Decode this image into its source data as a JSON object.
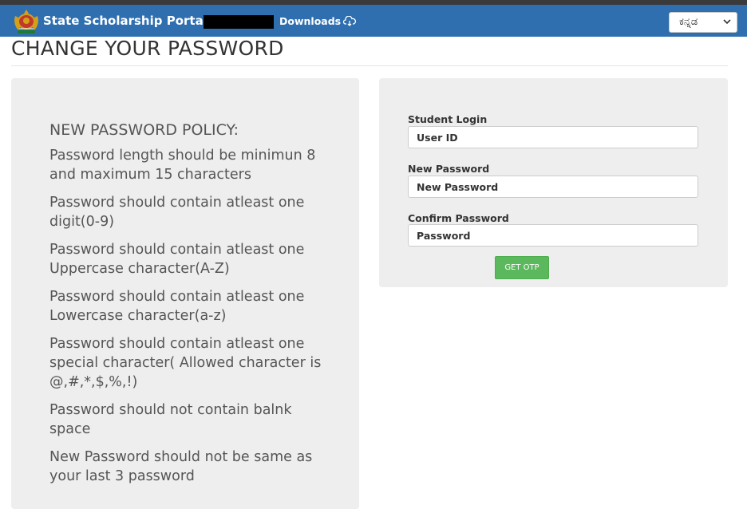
{
  "header": {
    "brand": "State Scholarship Portal",
    "downloads_label": "Downloads",
    "language_selected": "ಕನ್ನಡ"
  },
  "page": {
    "title": "CHANGE YOUR PASSWORD"
  },
  "policy": {
    "heading": "NEW PASSWORD POLICY:",
    "items": [
      "Password length should be minimun 8 and maximum 15 characters",
      "Password should contain atleast one digit(0-9)",
      "Password should contain atleast one Uppercase character(A-Z)",
      "Password should contain atleast one Lowercase character(a-z)",
      "Password should contain atleast one special character( Allowed character is @,#,*,$,%,!)",
      "Password should not contain balnk space",
      "New Password should not be same as your last 3 password"
    ]
  },
  "form": {
    "student_login_label": "Student Login",
    "user_id_placeholder": "User ID",
    "new_password_label": "New Password",
    "new_password_placeholder": "New Password",
    "confirm_password_label": "Confirm Password",
    "confirm_password_placeholder": "Password",
    "get_otp_label": "GET OTP"
  },
  "colors": {
    "navbar": "#2f6fb0",
    "panel": "#eeeeee",
    "button": "#5cb85c"
  }
}
